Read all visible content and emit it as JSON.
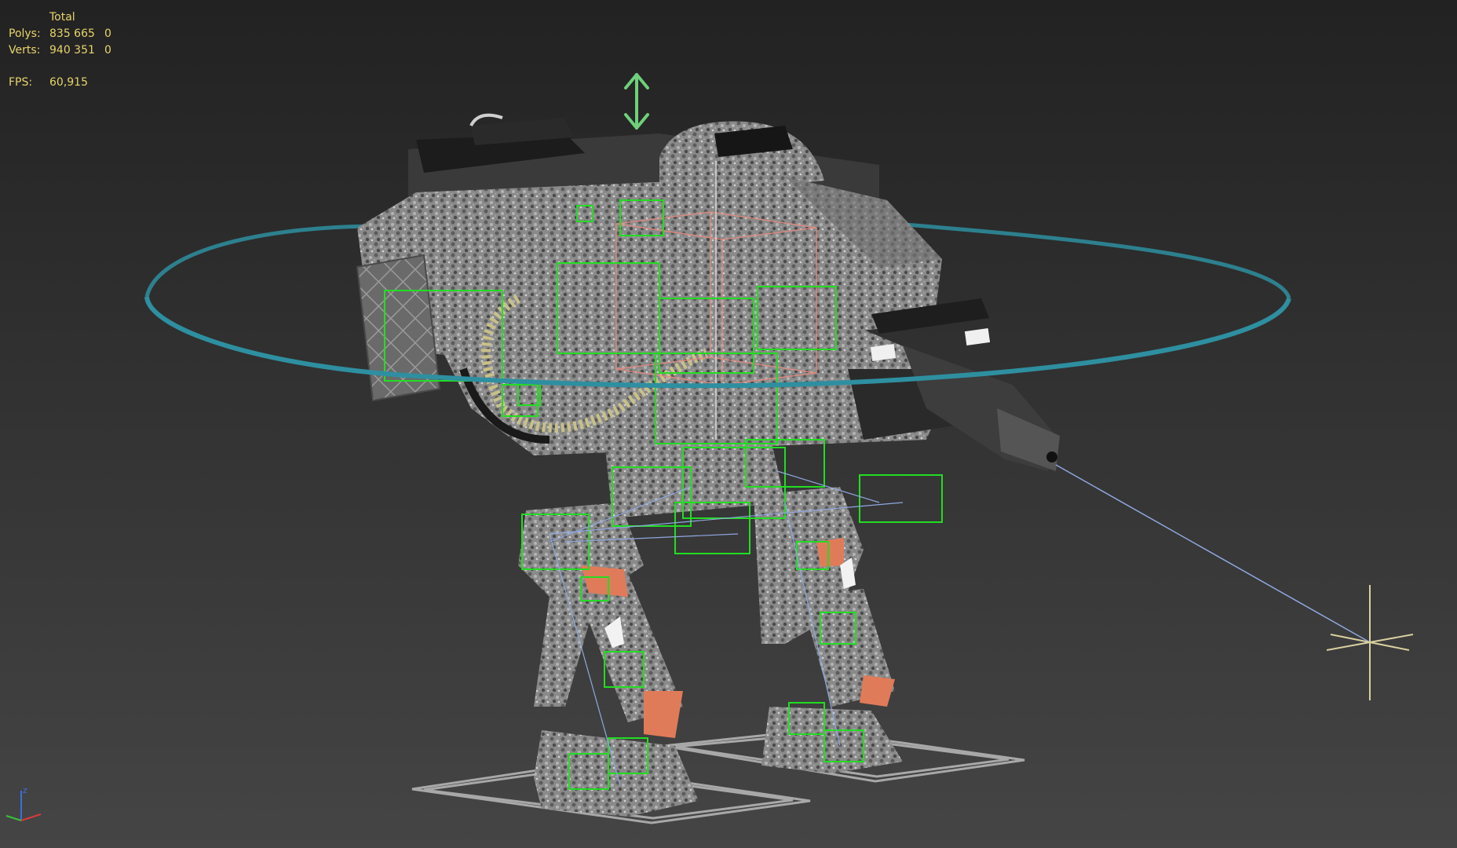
{
  "viewport": {
    "stats": {
      "header": "Total",
      "polys_label": "Polys:",
      "polys_total": "835 665",
      "polys_selected": "0",
      "verts_label": "Verts:",
      "verts_total": "940 351",
      "verts_selected": "0",
      "fps_label": "FPS:",
      "fps_value": "60,915"
    },
    "axis_gizmo": {
      "z_label": "z",
      "x_color": "#d43b3b",
      "y_color": "#3bbf3b",
      "z_color": "#3b6fe0"
    },
    "colors": {
      "rotate_ring": "#2e8fa0",
      "bone_box": "#22dd22",
      "move_arrow": "#6fd07a",
      "target_helper": "#d8cfa0",
      "link_line": "#8fa8e0",
      "selection_box": "#e08a80",
      "foot_plane": "#a8a8a8"
    }
  }
}
